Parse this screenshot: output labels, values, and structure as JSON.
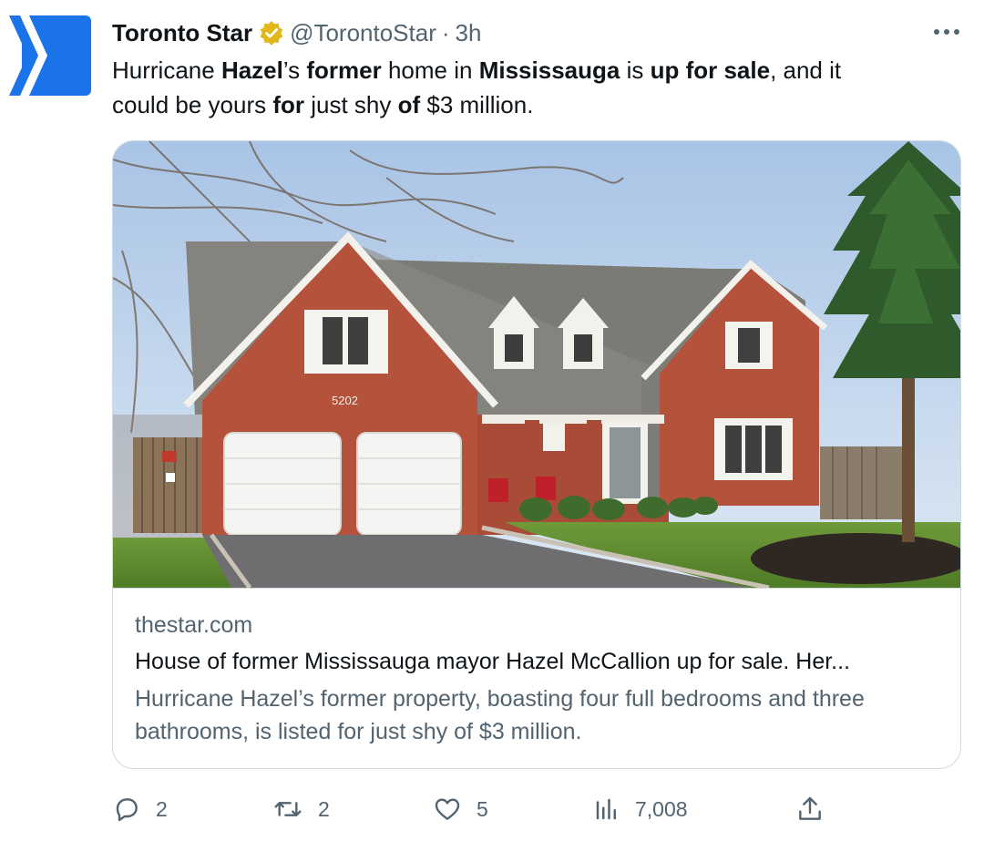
{
  "tweet": {
    "author_name": "Toronto Star",
    "handle": "@TorontoStar",
    "separator": "·",
    "time": "3h",
    "text": {
      "line1": [
        {
          "t": "Hurricane ",
          "b": false
        },
        {
          "t": "Hazel",
          "b": true
        },
        {
          "t": "’s ",
          "b": false
        },
        {
          "t": "former",
          "b": true
        },
        {
          "t": " home in ",
          "b": false
        },
        {
          "t": "Mississauga",
          "b": true
        },
        {
          "t": " is ",
          "b": false
        },
        {
          "t": "up for sale",
          "b": true
        },
        {
          "t": ", and it",
          "b": false
        }
      ],
      "line2": [
        {
          "t": "could be yours ",
          "b": false
        },
        {
          "t": "for",
          "b": true
        },
        {
          "t": " just shy ",
          "b": false
        },
        {
          "t": "of",
          "b": true
        },
        {
          "t": " $3 million.",
          "b": false
        }
      ]
    }
  },
  "card": {
    "domain": "thestar.com",
    "title": "House of former Mississauga mayor Hazel McCallion up for sale. Her...",
    "description": "Hurricane Hazel’s former property, boasting four full bedrooms and three bathrooms, is listed for just shy of $3 million.",
    "house_number": "5202"
  },
  "actions": {
    "replies": "2",
    "retweets": "2",
    "likes": "5",
    "views": "7,008"
  },
  "icons": {
    "avatar": "toronto-star-logo",
    "verified": "verified-badge-icon",
    "more": "more-icon",
    "reply": "reply-icon",
    "retweet": "retweet-icon",
    "like": "like-icon",
    "views": "views-icon",
    "share": "share-icon"
  },
  "colors": {
    "brand_blue": "#1a73e8",
    "badge_gold": "#e2b719",
    "muted": "#536471",
    "border": "#cfd9de"
  }
}
